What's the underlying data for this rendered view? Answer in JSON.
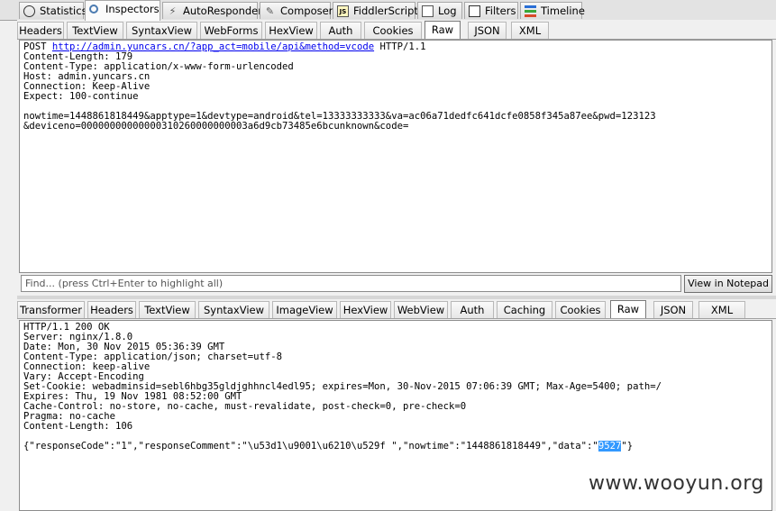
{
  "top_tabs": [
    {
      "label": "Statistics",
      "icon": "stopwatch-icon"
    },
    {
      "label": "Inspectors",
      "icon": "magnifier-icon"
    },
    {
      "label": "AutoResponder",
      "icon": "lightning-icon"
    },
    {
      "label": "Composer",
      "icon": "pencil-icon"
    },
    {
      "label": "FiddlerScript",
      "icon": "script-icon"
    },
    {
      "label": "Log",
      "icon": "log-icon"
    },
    {
      "label": "Filters",
      "icon": "checkbox-icon"
    },
    {
      "label": "Timeline",
      "icon": "timeline-icon"
    }
  ],
  "request_tabs": [
    "Headers",
    "TextView",
    "SyntaxView",
    "WebForms",
    "HexView",
    "Auth",
    "Cookies",
    "Raw",
    "JSON",
    "XML"
  ],
  "request": {
    "method": "POST",
    "url": "http://admin.yuncars.cn/?app_act=mobile/api&method=vcode",
    "protocol": "HTTP/1.1",
    "headers": [
      "Content-Length: 179",
      "Content-Type: application/x-www-form-urlencoded",
      "Host: admin.yuncars.cn",
      "Connection: Keep-Alive",
      "Expect: 100-continue"
    ],
    "body_line1": "nowtime=1448861818449&apptype=1&devtype=android&tel=13333333333&va=ac06a71dedfc641dcfe0858f345a87ee&pwd=123123",
    "body_line2": "&deviceno=00000000000000310260000000003a6d9cb73485e6bcunknown&code="
  },
  "find": {
    "placeholder": "Find... (press Ctrl+Enter to highlight all)"
  },
  "view_in_notepad": "View in Notepad",
  "response_tabs": [
    "Transformer",
    "Headers",
    "TextView",
    "SyntaxView",
    "ImageView",
    "HexView",
    "WebView",
    "Auth",
    "Caching",
    "Cookies",
    "Raw",
    "JSON",
    "XML"
  ],
  "response": {
    "lines": [
      "HTTP/1.1 200 OK",
      "Server: nginx/1.8.0",
      "Date: Mon, 30 Nov 2015 05:36:39 GMT",
      "Content-Type: application/json; charset=utf-8",
      "Connection: keep-alive",
      "Vary: Accept-Encoding",
      "Set-Cookie: webadminsid=sebl6hbg35gldjghhncl4edl95; expires=Mon, 30-Nov-2015 07:06:39 GMT; Max-Age=5400; path=/",
      "Expires: Thu, 19 Nov 1981 08:52:00 GMT",
      "Cache-Control: no-store, no-cache, must-revalidate, post-check=0, pre-check=0",
      "Pragma: no-cache",
      "Content-Length: 106"
    ],
    "json_prefix": "{\"responseCode\":\"1\",\"responseComment\":\"\\u53d1\\u9001\\u6210\\u529f \",\"nowtime\":\"1448861818449\",\"data\":\"",
    "json_selected": "9527",
    "json_suffix": "\"}"
  },
  "watermark": "www.wooyun.org"
}
